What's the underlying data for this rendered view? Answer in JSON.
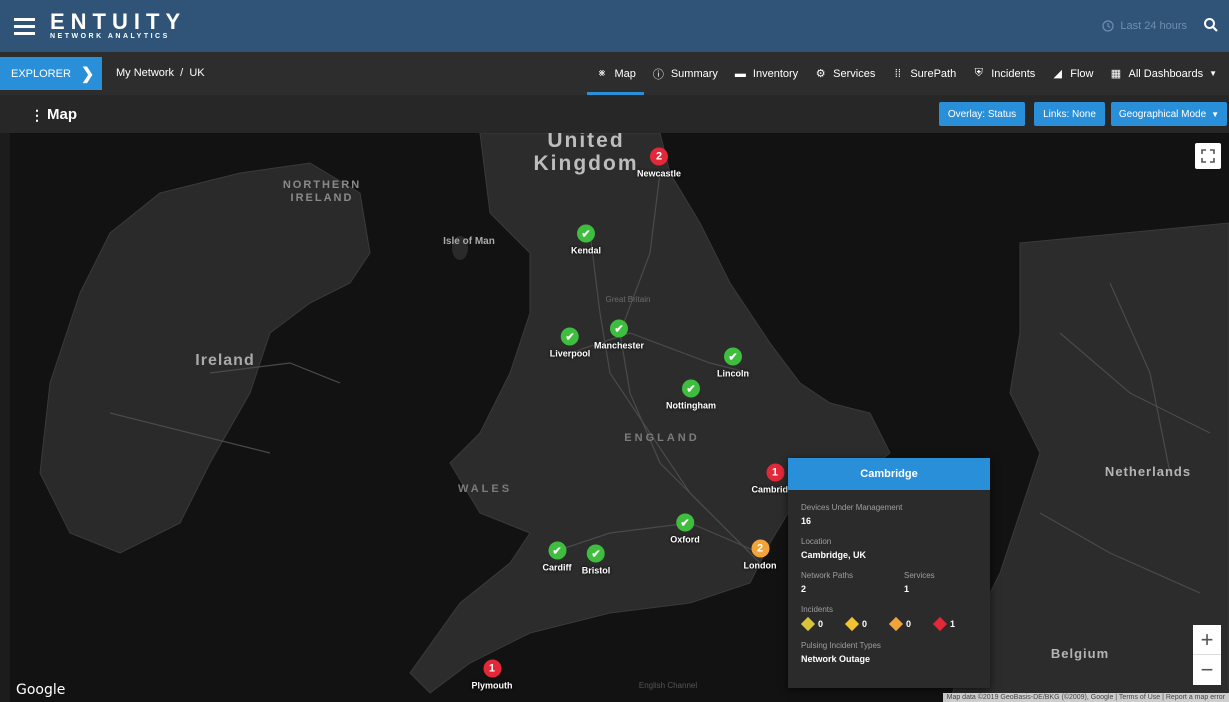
{
  "header": {
    "brand_name": "ENTUITY",
    "brand_sub": "NETWORK ANALYTICS",
    "time_range": "Last 24 hours"
  },
  "nav": {
    "explorer_label": "EXPLORER",
    "breadcrumb": "My Network  /  UK",
    "tabs": [
      {
        "label": "Map",
        "icon": "map-icon"
      },
      {
        "label": "Summary",
        "icon": "info-icon"
      },
      {
        "label": "Inventory",
        "icon": "folder-icon"
      },
      {
        "label": "Services",
        "icon": "services-icon"
      },
      {
        "label": "SurePath",
        "icon": "surepath-icon"
      },
      {
        "label": "Incidents",
        "icon": "shield-icon"
      },
      {
        "label": "Flow",
        "icon": "flow-icon"
      },
      {
        "label": "All Dashboards",
        "icon": "dashboard-icon"
      }
    ]
  },
  "page": {
    "title": "Map",
    "overlay_label": "Overlay: Status",
    "links_label": "Links: None",
    "mode_label": "Geographical Mode"
  },
  "map_labels": {
    "uk_line1": "United",
    "uk_line2": "Kingdom",
    "northern_ireland_line1": "NORTHERN",
    "northern_ireland_line2": "IRELAND",
    "isle_of_man": "Isle of Man",
    "ireland": "Ireland",
    "great_britain": "Great Britain",
    "england": "ENGLAND",
    "wales": "WALES",
    "netherlands": "Netherlands",
    "belgium": "Belgium",
    "english_channel": "English Channel"
  },
  "sites": [
    {
      "name": "Newcastle",
      "status": "red",
      "count": "2"
    },
    {
      "name": "Kendal",
      "status": "ok",
      "count": ""
    },
    {
      "name": "Liverpool",
      "status": "ok",
      "count": ""
    },
    {
      "name": "Manchester",
      "status": "ok",
      "count": ""
    },
    {
      "name": "Lincoln",
      "status": "ok",
      "count": ""
    },
    {
      "name": "Nottingham",
      "status": "ok",
      "count": ""
    },
    {
      "name": "Cambridge",
      "status": "red",
      "count": "1"
    },
    {
      "name": "Oxford",
      "status": "ok",
      "count": ""
    },
    {
      "name": "London",
      "status": "orange",
      "count": "2"
    },
    {
      "name": "Cardiff",
      "status": "ok",
      "count": ""
    },
    {
      "name": "Bristol",
      "status": "ok",
      "count": ""
    },
    {
      "name": "Plymouth",
      "status": "red",
      "count": "1"
    }
  ],
  "popup": {
    "title": "Cambridge",
    "devices_label": "Devices Under Management",
    "devices_value": "16",
    "location_label": "Location",
    "location_value": "Cambridge, UK",
    "paths_label": "Network Paths",
    "paths_value": "2",
    "services_label": "Services",
    "services_value": "1",
    "incidents_label": "Incidents",
    "incidents": [
      {
        "value": "0",
        "color": "#d8c43a"
      },
      {
        "value": "0",
        "color": "#f2c230"
      },
      {
        "value": "0",
        "color": "#f2a33a"
      },
      {
        "value": "1",
        "color": "#e3283a"
      }
    ],
    "pulsing_label": "Pulsing Incident Types",
    "pulsing_value": "Network Outage"
  },
  "footer": {
    "google": "Google",
    "attribution": "Map data ©2019 GeoBasis-DE/BKG (©2009), Google  |  Terms of Use  |  Report a map error"
  },
  "colors": {
    "header_bg": "#2f5478",
    "accent": "#2a8fd9",
    "ok": "#3fbd3f",
    "critical": "#e3283a",
    "major": "#f2a33a"
  }
}
